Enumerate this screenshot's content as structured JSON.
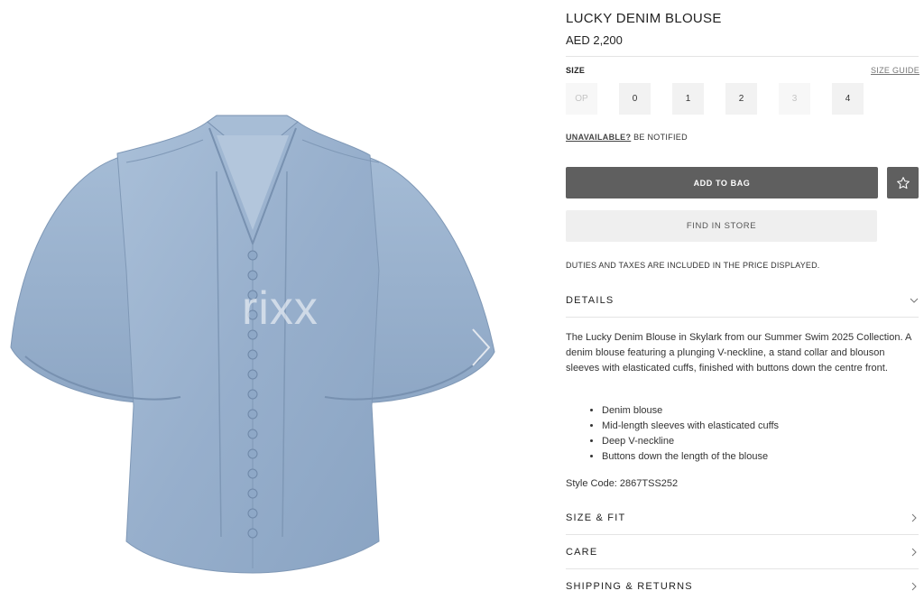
{
  "gallery": {
    "watermark": "rixx"
  },
  "product": {
    "title": "LUCKY DENIM BLOUSE",
    "price": "AED 2,200",
    "size_label": "SIZE",
    "size_guide_label": "SIZE GUIDE",
    "sizes": [
      {
        "label": "OP",
        "available": false
      },
      {
        "label": "0",
        "available": true
      },
      {
        "label": "1",
        "available": true
      },
      {
        "label": "2",
        "available": true
      },
      {
        "label": "3",
        "available": false
      },
      {
        "label": "4",
        "available": true
      }
    ],
    "unavailable_link": "UNAVAILABLE?",
    "unavailable_text": "BE NOTIFIED",
    "add_to_bag_label": "ADD TO BAG",
    "find_in_store_label": "FIND IN STORE",
    "duties_text": "DUTIES AND TAXES ARE INCLUDED IN THE PRICE DISPLAYED.",
    "details_label": "DETAILS",
    "description": "The Lucky Denim Blouse in Skylark from our Summer Swim 2025 Collection. A denim blouse featuring a plunging V-neckline, a stand collar and blouson sleeves with elasticated cuffs, finished with buttons down the centre front.",
    "bullets": [
      "Denim blouse",
      "Mid-length sleeves with elasticated cuffs",
      "Deep V-neckline",
      "Buttons down the length of the blouse"
    ],
    "style_code": "Style Code: 2867TSS252",
    "size_fit_label": "SIZE & FIT",
    "care_label": "CARE",
    "shipping_label": "SHIPPING & RETURNS"
  },
  "colors": {
    "denim": "#9db4d0",
    "primary_button": "#5f5f5f",
    "secondary_button": "#efefef"
  }
}
